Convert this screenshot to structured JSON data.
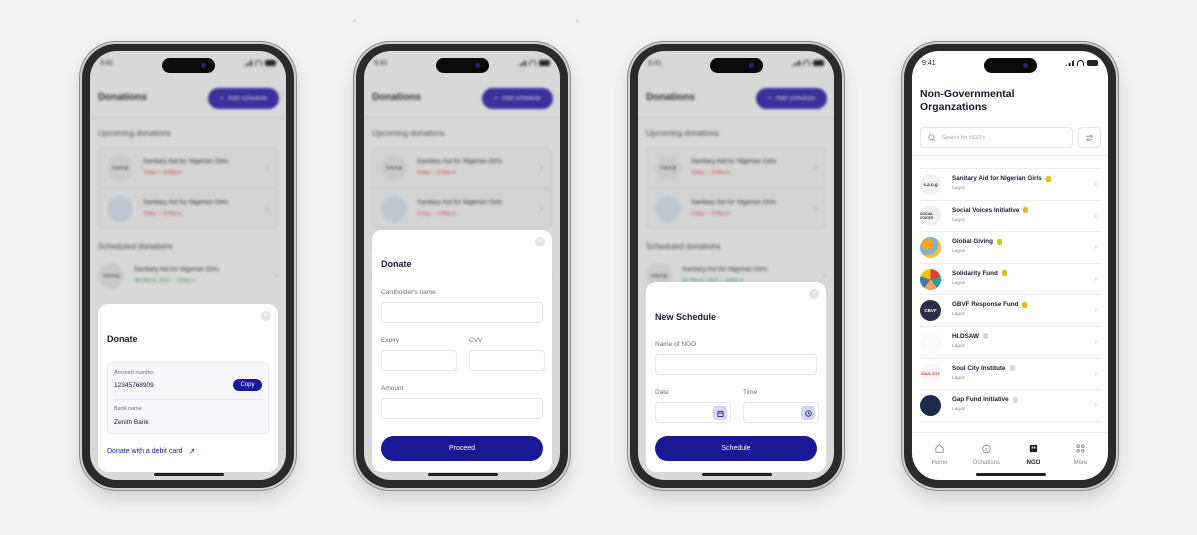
{
  "status_bar": {
    "time": "9:41"
  },
  "donations_screen": {
    "title": "Donations",
    "add_schedule_label": "Add schedule",
    "upcoming_heading": "Upcoming donations",
    "upcoming": [
      {
        "name": "Sanitary Aid for Nigerian Girls",
        "logo": "s.a.n.g",
        "day": "Today",
        "time": "8:00p.m"
      },
      {
        "name": "Sanitary Aid for Nigerian Girls",
        "logo": "",
        "day": "Today",
        "time": "8:00p.m"
      }
    ],
    "scheduled_heading": "Scheduled donations",
    "scheduled": [
      {
        "name": "Sanitary Aid for Nigerian Girls",
        "logo": "s.a.n.g",
        "day": "5th March, 2023",
        "time": "8:00p.m"
      }
    ]
  },
  "donate_bank_modal": {
    "title": "Donate",
    "account_number_label": "Account number",
    "account_number": "12345768909",
    "copy_label": "Copy",
    "bank_name_label": "Bank name",
    "bank_name": "Zenith Bank",
    "debit_card_link": "Donate with a debit card",
    "close_symbol": "×"
  },
  "donate_card_modal": {
    "title": "Donate",
    "cardholder_label": "Cardholder's name",
    "expiry_label": "Expiry",
    "cvv_label": "CVV",
    "amount_label": "Amount",
    "proceed_label": "Proceed",
    "close_symbol": "×"
  },
  "new_schedule_modal": {
    "title": "New Schedule",
    "ngo_name_label": "Name of NGO",
    "date_label": "Date",
    "time_label": "Time",
    "schedule_label": "Schedule",
    "close_symbol": "×"
  },
  "ngo_screen": {
    "title_line1": "Non-Governmental",
    "title_line2": "Organzations",
    "search_placeholder": "Search for NGO's",
    "ngos": [
      {
        "name": "Sanitary Aid for Nigerian Girls",
        "location": "Lagos",
        "logo": "s.a.n.g",
        "verified": true
      },
      {
        "name": "Social Voices Initiative",
        "location": "Lagos",
        "logo": "SOCIAL VOICES",
        "verified": true
      },
      {
        "name": "Global Giving",
        "location": "Lagos",
        "logo": "",
        "verified": true
      },
      {
        "name": "Solidarity Fund",
        "location": "Lagos",
        "logo": "",
        "verified": true
      },
      {
        "name": "GBVF Response Fund",
        "location": "Lagos",
        "logo": "CBVF",
        "verified": true
      },
      {
        "name": "HI.DSAW",
        "location": "Lagos",
        "logo": "",
        "verified": false
      },
      {
        "name": "Soul City Institute",
        "location": "Lagos",
        "logo": "SOUL CITY",
        "verified": false
      },
      {
        "name": "Gap Fund Initiative",
        "location": "Lagos",
        "logo": "",
        "verified": false
      }
    ],
    "tabs": [
      {
        "label": "Home",
        "icon": "home-icon",
        "active": false
      },
      {
        "label": "Donations",
        "icon": "donations-icon",
        "active": false
      },
      {
        "label": "NGO",
        "icon": "ngo-icon",
        "active": true
      },
      {
        "label": "More",
        "icon": "more-icon",
        "active": false
      }
    ]
  },
  "colors": {
    "primary": "#1a1896",
    "verified": "#d9c21a",
    "unverified": "#d8d8d8",
    "today": "#e24a4a",
    "scheduled": "#3da35d"
  }
}
